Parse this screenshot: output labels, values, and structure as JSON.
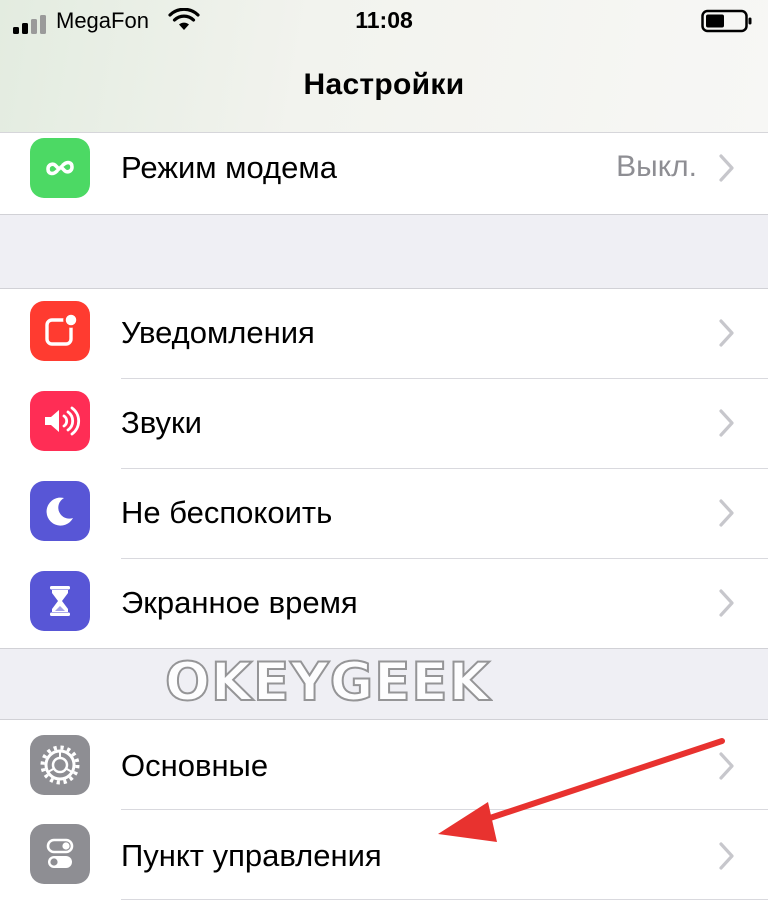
{
  "status_bar": {
    "carrier": "MegaFon",
    "time": "11:08",
    "icons": [
      "signal-icon",
      "wifi-icon",
      "battery-icon"
    ]
  },
  "nav": {
    "title": "Настройки"
  },
  "groups": [
    {
      "rows": [
        {
          "label": "Режим модема",
          "value": "Выкл.",
          "icon": "personal-hotspot-icon",
          "icon_color": "#4cd964"
        }
      ]
    },
    {
      "rows": [
        {
          "label": "Уведомления",
          "icon": "notifications-icon",
          "icon_color": "#ff3b30"
        },
        {
          "label": "Звуки",
          "icon": "sounds-icon",
          "icon_color": "#ff2d55"
        },
        {
          "label": "Не беспокоить",
          "icon": "moon-icon",
          "icon_color": "#5856d6"
        },
        {
          "label": "Экранное время",
          "icon": "hourglass-icon",
          "icon_color": "#5856d6"
        }
      ]
    },
    {
      "rows": [
        {
          "label": "Основные",
          "icon": "gear-icon",
          "icon_color": "#8e8e93"
        },
        {
          "label": "Пункт управления",
          "icon": "toggles-icon",
          "icon_color": "#8e8e93"
        }
      ]
    }
  ],
  "watermark": {
    "text": "OKEYGEEK"
  },
  "annotation": {
    "arrow_color": "#e8322f",
    "points_to": "Пункт управления"
  }
}
